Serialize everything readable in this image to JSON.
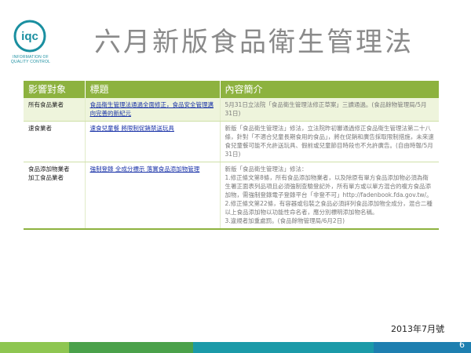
{
  "logo": {
    "brand": "iqc",
    "line1": "INFORMATION OF",
    "line2": "QUALITY CONTROL"
  },
  "title": "六月新版食品衛生管理法",
  "table": {
    "headers": [
      "影響對象",
      "標題",
      "內容簡介"
    ],
    "rows": [
      {
        "target": [
          "所有食品業者"
        ],
        "topic": "食品衛生管理法通過全面修正，食品安全管理邁向完善的新紀元",
        "content": [
          "5月31日立法院「食品衛生管理法修正草案」三讀通過。(食品餘物管理局/5月31日)"
        ]
      },
      {
        "target": [
          "速食業者"
        ],
        "topic": "速食兒童餐 將限制促銷禁送玩具",
        "content": [
          "新版「食品衛生管理法」修法，立法院昨初審通過修正食品衛生管理法第二十八條，針對「不適合兒童長期食用的食品」，將在促銷和廣告採取限制措施，未來速食兒童餐可能不允許送玩具、假前或兒童節目時段也不允許廣告。(自由時報/5月31日)"
        ]
      },
      {
        "target": [
          "食品添加物業者",
          "加工食品業者"
        ],
        "topic": "強制登錄 全成分標示 落實食品添加物管理",
        "content": [
          "新版「食品衛生管理法」修法：",
          "1.修正條文第8條，所有食品添加物業者，以及除原有單方食品添加物必須為衛生署正面表列品項且必須強制查驗登記外，所有單方或以單方混合的複方食品添加物，需強制登錄電子登錄平台「非登不可」http://fadenbook.fda.gov.tw/。",
          "2.修正條文第22條，有容器或包裝之食品必須詳列食品添加物全成分，混合二種以上食品添加物以功能性命名者，應分別標明添加物名稱。",
          "3.違規者加重處罰。(食品餘物管理局/6月2日)"
        ]
      }
    ]
  },
  "footer": {
    "date": "2013年7月號",
    "page_number": "6"
  },
  "colors": {
    "header_bg": "#8db23f",
    "title_gray": "#8a8a8a",
    "link_blue": "#1a33a8",
    "bar_segments": [
      "#8ec651",
      "#4aa14a",
      "#1b9aa8",
      "#1e7fb0"
    ]
  }
}
